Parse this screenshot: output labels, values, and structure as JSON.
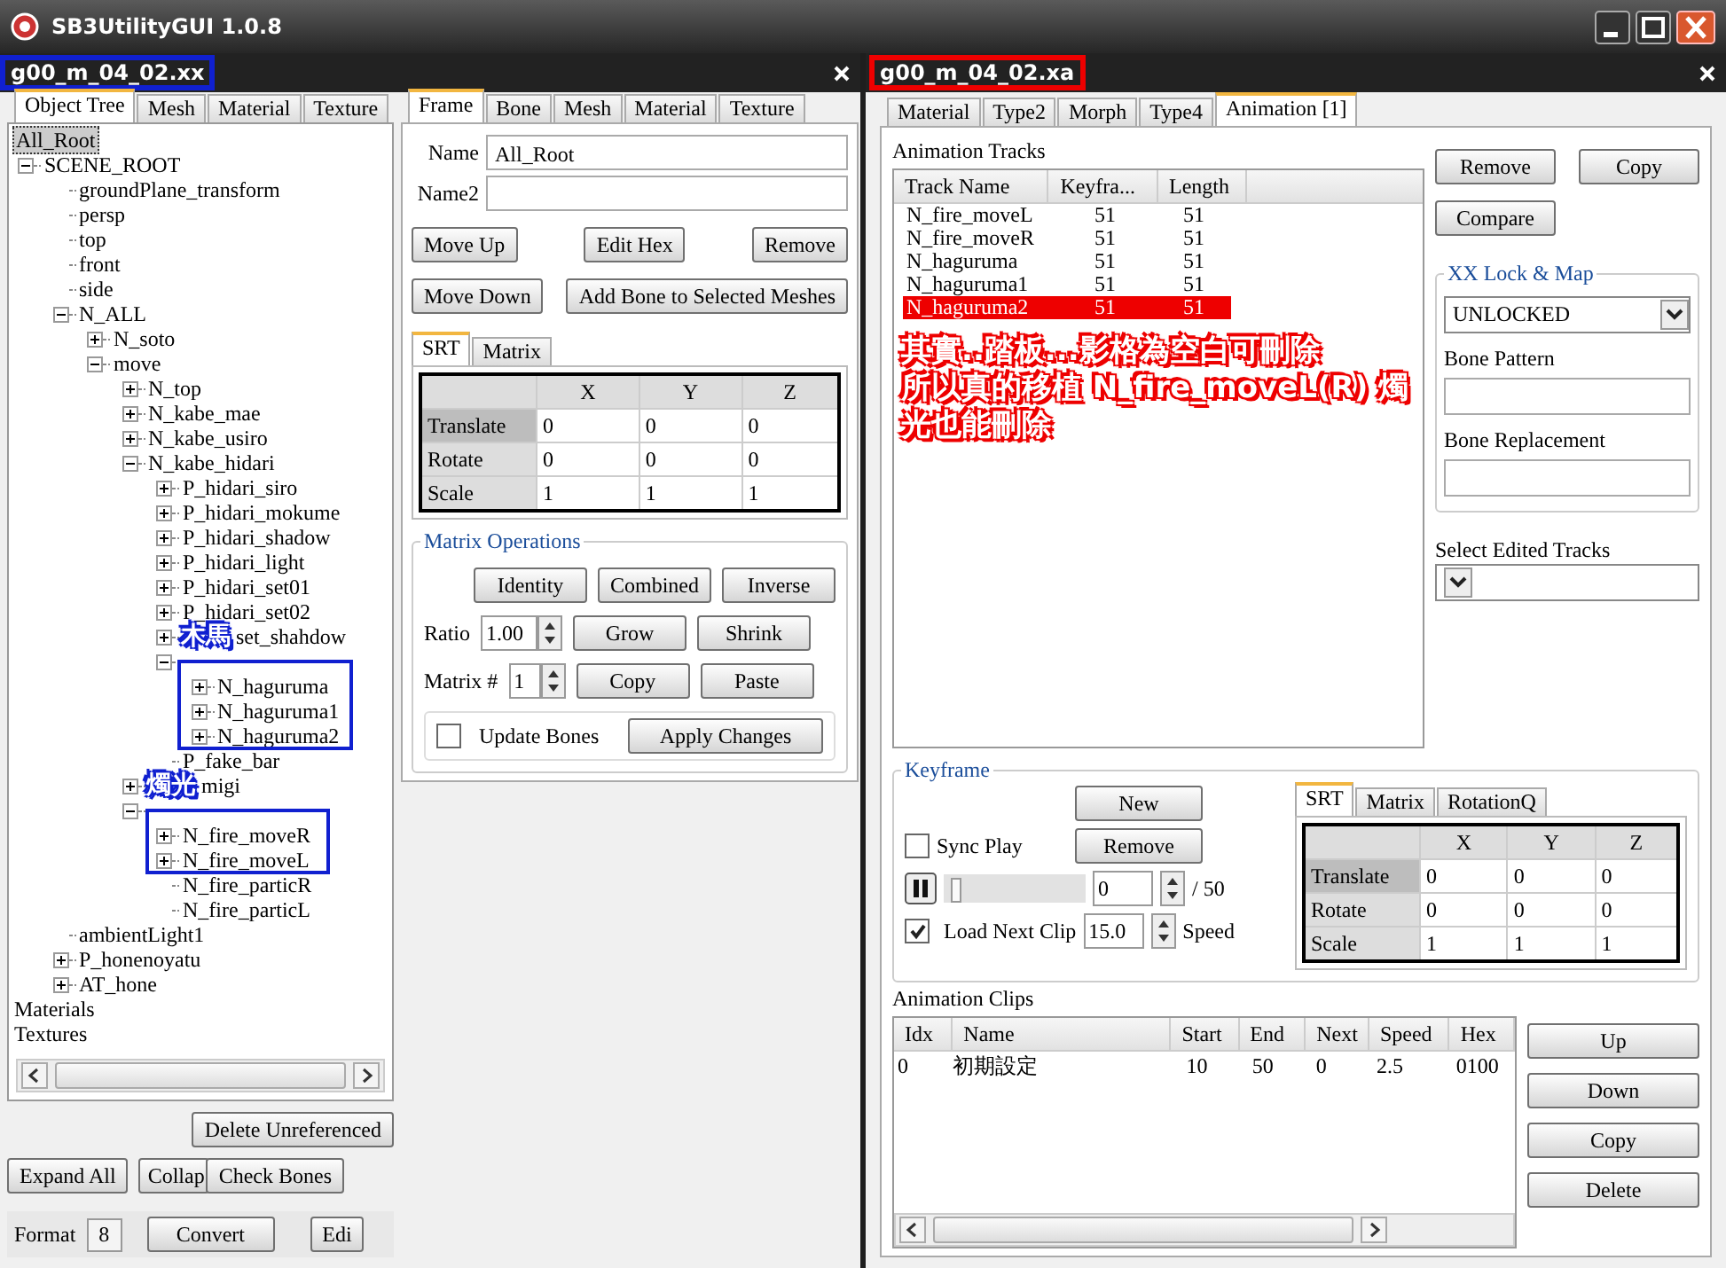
{
  "window": {
    "title": "SB3UtilityGUI 1.0.8"
  },
  "left_document": {
    "title": "g00_m_04_02.xx"
  },
  "left_tabs": [
    {
      "label": "Object Tree",
      "selected": true
    },
    {
      "label": "Mesh",
      "selected": false
    },
    {
      "label": "Material",
      "selected": false
    },
    {
      "label": "Texture",
      "selected": false
    }
  ],
  "tree": [
    {
      "label": "All_Root",
      "selected": true,
      "children": [
        {
          "label": "SCENE_ROOT",
          "selected": false,
          "expanded": true,
          "children": [
            {
              "label": "groundPlane_transform",
              "selected": false
            },
            {
              "label": "persp",
              "selected": false
            },
            {
              "label": "top",
              "selected": false
            },
            {
              "label": "front",
              "selected": false
            },
            {
              "label": "side",
              "selected": false
            },
            {
              "label": "N_ALL",
              "selected": false,
              "expanded": true,
              "children": [
                {
                  "label": "N_soto",
                  "selected": false,
                  "expanded": false
                },
                {
                  "label": "move",
                  "selected": false,
                  "expanded": true,
                  "children": [
                    {
                      "label": "N_top",
                      "selected": false,
                      "expanded": false
                    },
                    {
                      "label": "N_kabe_mae",
                      "selected": false,
                      "expanded": false
                    },
                    {
                      "label": "N_kabe_usiro",
                      "selected": false,
                      "expanded": false
                    },
                    {
                      "label": "N_kabe_hidari",
                      "selected": false,
                      "expanded": true,
                      "children": [
                        {
                          "label": "P_hidari_siro",
                          "selected": false,
                          "expanded": false
                        },
                        {
                          "label": "P_hidari_mokume",
                          "selected": false,
                          "expanded": false
                        },
                        {
                          "label": "P_hidari_shadow",
                          "selected": false,
                          "expanded": false
                        },
                        {
                          "label": "P_hidari_light",
                          "selected": false,
                          "expanded": false
                        },
                        {
                          "label": "P_hidari_set01",
                          "selected": false,
                          "expanded": false
                        },
                        {
                          "label": "P_hidari_set02",
                          "selected": false,
                          "expanded": false
                        },
                        {
                          "label": "set_shahdow",
                          "selected": false,
                          "annotation": "木馬",
                          "expanded": false
                        },
                        {
                          "expanded": true,
                          "children": [
                            {
                              "label": "N_haguruma",
                              "selected": false,
                              "expanded": false
                            },
                            {
                              "label": "N_haguruma1",
                              "selected": false,
                              "expanded": false
                            },
                            {
                              "label": "N_haguruma2",
                              "selected": false,
                              "expanded": false
                            }
                          ]
                        },
                        {
                          "label": "P_fake_bar",
                          "selected": false
                        }
                      ]
                    },
                    {
                      "label": "migi",
                      "selected": false,
                      "annotation": "燭光",
                      "expanded": false
                    },
                    {
                      "expanded": true,
                      "children": [
                        {
                          "label": "N_fire_moveR",
                          "selected": false,
                          "expanded": false
                        },
                        {
                          "label": "N_fire_moveL",
                          "selected": false,
                          "expanded": false
                        },
                        {
                          "label": "N_fire_particR",
                          "selected": false
                        },
                        {
                          "label": "N_fire_particL",
                          "selected": false
                        }
                      ]
                    }
                  ]
                }
              ]
            },
            {
              "label": "ambientLight1",
              "selected": false
            },
            {
              "label": "P_honenoyatu",
              "selected": false,
              "expanded": false
            },
            {
              "label": "AT_hone",
              "selected": false,
              "expanded": false
            }
          ]
        }
      ]
    },
    {
      "label": "Materials",
      "selected": false
    },
    {
      "label": "Textures",
      "selected": false
    }
  ],
  "tree_buttons": {
    "delete_unreferenced": "Delete Unreferenced",
    "expand_all": "Expand All",
    "collapse": "Collap",
    "check_bones": "Check Bones"
  },
  "format": {
    "label": "Format",
    "value": "8",
    "convert": "Convert",
    "edit": "Edi"
  },
  "frame_tabs": [
    {
      "label": "Frame",
      "selected": true
    },
    {
      "label": "Bone",
      "selected": false
    },
    {
      "label": "Mesh",
      "selected": false
    },
    {
      "label": "Material",
      "selected": false
    },
    {
      "label": "Texture",
      "selected": false
    }
  ],
  "name_field": {
    "label": "Name",
    "value": "All_Root"
  },
  "name2_field": {
    "label": "Name2"
  },
  "frame_buttons": [
    [
      "Move Up",
      "Edit Hex",
      "Remove"
    ],
    [
      "Move Down",
      "Add Bone to Selected Meshes"
    ]
  ],
  "srt_tabs": [
    {
      "label": "SRT",
      "selected": true
    },
    {
      "label": "Matrix",
      "selected": false
    }
  ],
  "srt_table": {
    "columns": [
      "X",
      "Y",
      "Z"
    ],
    "rows": [
      {
        "label": "Translate",
        "selected": true,
        "values": [
          "0",
          "0",
          "0"
        ]
      },
      {
        "label": "Rotate",
        "selected": false,
        "values": [
          "0",
          "0",
          "0"
        ]
      },
      {
        "label": "Scale",
        "selected": false,
        "values": [
          "1",
          "1",
          "1"
        ]
      }
    ]
  },
  "matrix_operations": {
    "title": "Matrix Operations",
    "buttons": [
      "Identity",
      "Combined",
      "Inverse"
    ],
    "ratio": {
      "label": "Ratio",
      "value": "1.00"
    },
    "ratio_buttons": [
      "Grow",
      "Shrink"
    ],
    "matrix": {
      "label": "Matrix #",
      "value": "1"
    },
    "matrix_buttons": [
      "Copy",
      "Paste"
    ],
    "update_bones": {
      "label": "Update Bones",
      "checked": false
    },
    "apply": "Apply Changes"
  },
  "right_document": {
    "title": "g00_m_04_02.xa"
  },
  "right_tabs": [
    {
      "label": "Material",
      "selected": false
    },
    {
      "label": "Type2",
      "selected": false
    },
    {
      "label": "Morph",
      "selected": false
    },
    {
      "label": "Type4",
      "selected": false
    },
    {
      "label": "Animation [1]",
      "selected": true
    }
  ],
  "animation_tracks": {
    "title": "Animation Tracks",
    "columns": [
      "Track Name",
      "Keyfra...",
      "Length"
    ],
    "rows": [
      {
        "cells": [
          "N_fire_moveL",
          "51",
          "51"
        ],
        "selected": false
      },
      {
        "cells": [
          "N_fire_moveR",
          "51",
          "51"
        ],
        "selected": false
      },
      {
        "cells": [
          "N_haguruma",
          "51",
          "51"
        ],
        "selected": false
      },
      {
        "cells": [
          "N_haguruma1",
          "51",
          "51"
        ],
        "selected": false
      },
      {
        "cells": [
          "N_haguruma2",
          "51",
          "51"
        ],
        "selected": true
      }
    ]
  },
  "track_buttons": {
    "remove": "Remove",
    "copy": "Copy",
    "compare": "Compare"
  },
  "lock_map": {
    "title": "XX Lock & Map",
    "value": "UNLOCKED",
    "bone_pattern": "Bone Pattern",
    "bone_replacement": "Bone Replacement"
  },
  "select_edited_tracks": {
    "label": "Select Edited Tracks"
  },
  "keyframe": {
    "title": "Keyframe",
    "new": "New",
    "remove": "Remove",
    "sync_play": {
      "label": "Sync Play",
      "checked": false
    },
    "level": 0.0,
    "frame": "0",
    "total": "/ 50",
    "load_next_clip": {
      "label": "Load Next Clip",
      "checked": true
    },
    "speed_value": "15.0",
    "speed_label": "Speed"
  },
  "keyframe_tabs": [
    {
      "label": "SRT",
      "selected": true
    },
    {
      "label": "Matrix",
      "selected": false
    },
    {
      "label": "RotationQ",
      "selected": false
    }
  ],
  "keyframe_table": {
    "columns": [
      "X",
      "Y",
      "Z"
    ],
    "rows": [
      {
        "label": "Translate",
        "selected": true,
        "values": [
          "0",
          "0",
          "0"
        ]
      },
      {
        "label": "Rotate",
        "selected": false,
        "values": [
          "0",
          "0",
          "0"
        ]
      },
      {
        "label": "Scale",
        "selected": false,
        "values": [
          "1",
          "1",
          "1"
        ]
      }
    ]
  },
  "animation_clips": {
    "title": "Animation Clips",
    "columns": [
      "Idx",
      "Name",
      "Start",
      "End",
      "Next",
      "Speed",
      "Hex"
    ],
    "rows": [
      [
        "0",
        "初期設定",
        "10",
        "50",
        "0",
        "2.5",
        "0100"
      ]
    ]
  },
  "clip_buttons": [
    "Up",
    "Down",
    "Copy",
    "Delete"
  ],
  "annotations": {
    "note_lines": [
      "其實..踏板...影格為空白可刪除",
      "所以真的移植 N_fire_moveL(R) 燭光也能刪除"
    ]
  }
}
